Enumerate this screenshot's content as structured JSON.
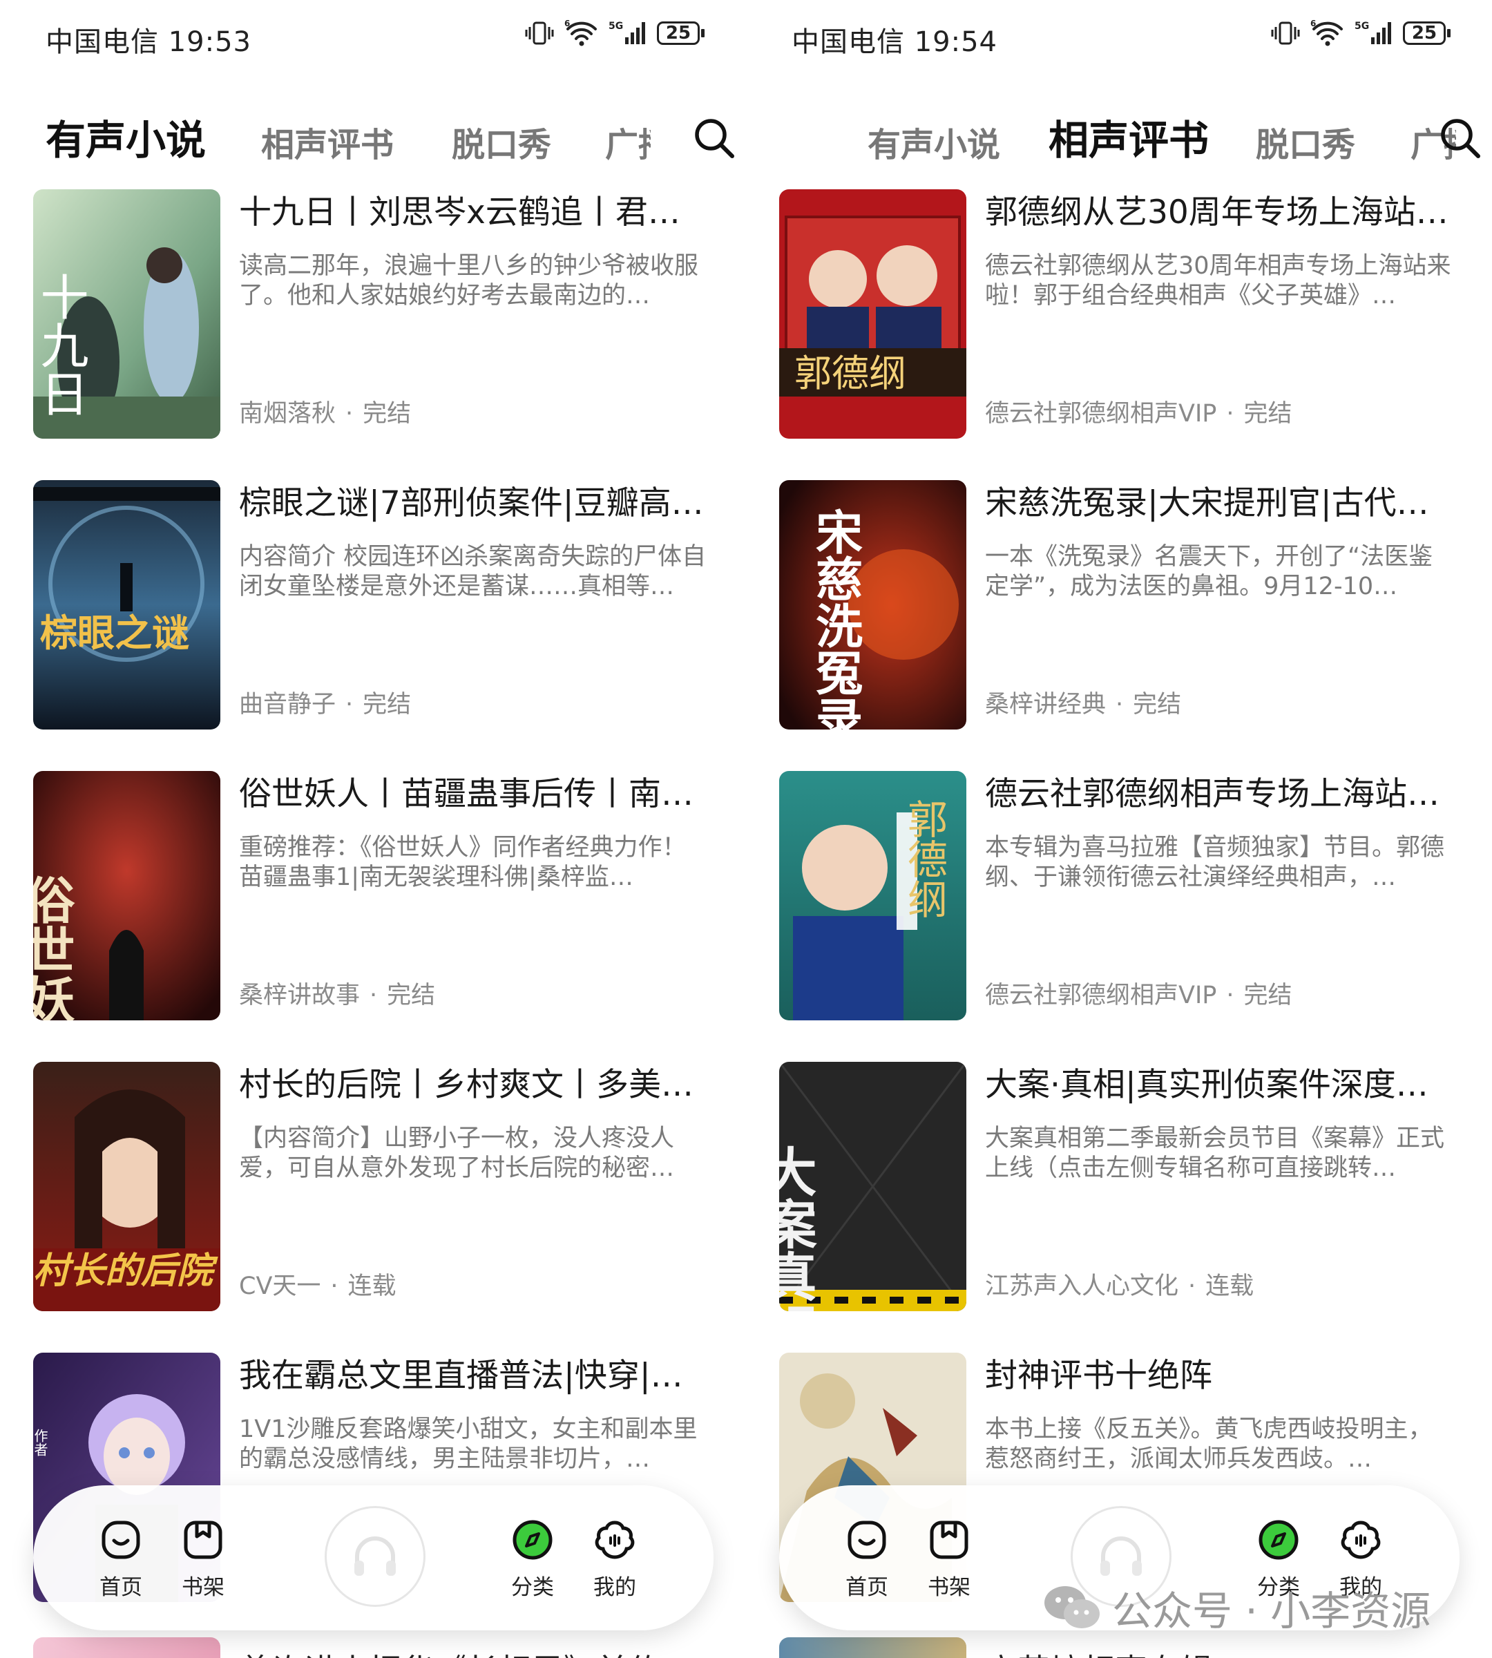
{
  "left": {
    "status": {
      "carrier_time": "中国电信 19:53",
      "battery": "25",
      "signal": "5G"
    },
    "tabs": [
      "有声小说",
      "相声评书",
      "脱口秀",
      "广播"
    ],
    "active_tab": 0,
    "books": [
      {
        "title": "十九日丨刘思岑x云鹤追丨君…",
        "desc": "读高二那年，浪遍十里八乡的钟少爷被收服了。他和人家姑娘约好考去最南边的…",
        "author": "南烟落秋",
        "status": "完结",
        "cover_text": "十九日"
      },
      {
        "title": "棕眼之谜|7部刑侦案件|豆瓣高…",
        "desc": "内容简介 校园连环凶杀案离奇失踪的尸体自闭女童坠楼是意外还是蓄谋……真相等…",
        "author": "曲音静子",
        "status": "完结",
        "cover_text": "棕眼之谜"
      },
      {
        "title": "俗世妖人丨苗疆蛊事后传丨南…",
        "desc": "重磅推荐：《俗世妖人》同作者经典力作！苗疆蛊事1|南无袈裟理科佛|桑梓监…",
        "author": "桑梓讲故事",
        "status": "完结",
        "cover_text": "俗世妖人"
      },
      {
        "title": "村长的后院丨乡村爽文丨多美…",
        "desc": "【内容简介】山野小子一枚，没人疼没人爱，可自从意外发现了村长后院的秘密…",
        "author": "CV天一",
        "status": "连载",
        "cover_text": "村长的后院"
      },
      {
        "title": "我在霸总文里直播普法|快穿|…",
        "desc": "1V1沙雕反套路爆笑小甜文，女主和副本里的霸总没感情线，男主陆景非切片，…",
        "author": "",
        "status": "",
        "cover_text": "作者"
      }
    ],
    "peek_title": "曾许诺丨桐华《长相思》前传"
  },
  "right": {
    "status": {
      "carrier_time": "中国电信 19:54",
      "battery": "25",
      "signal": "5G"
    },
    "tabs": [
      "有声小说",
      "相声评书",
      "脱口秀",
      "广播"
    ],
    "active_tab": 1,
    "books": [
      {
        "title": "郭德纲从艺30周年专场上海站…",
        "desc": "德云社郭德纲从艺30周年相声专场上海站来啦！郭于组合经典相声《父子英雄》…",
        "author": "德云社郭德纲相声VIP",
        "status": "完结",
        "cover_text": "郭德纲"
      },
      {
        "title": "宋慈洗冤录|大宋提刑官|古代…",
        "desc": "一本《洗冤录》名震天下，开创了“法医鉴定学”，成为法医的鼻祖。9月12-10…",
        "author": "桑梓讲经典",
        "status": "完结",
        "cover_text": "宋慈洗冤录"
      },
      {
        "title": "德云社郭德纲相声专场上海站…",
        "desc": "本专辑为喜马拉雅【音频独家】节目。郭德纲、于谦领衔德云社演绎经典相声，…",
        "author": "德云社郭德纲相声VIP",
        "status": "完结",
        "cover_text": "郭德纲"
      },
      {
        "title": "大案·真相|真实刑侦案件深度…",
        "desc": "大案真相第二季最新会员节目《案幕》正式上线（点击左侧专辑名称可直接跳转…",
        "author": "江苏声入人心文化",
        "status": "连载",
        "cover_text": "大案真相"
      },
      {
        "title": "封神评书十绝阵",
        "desc": "本书上接《反五关》。黄飞虎西岐投明主，惹怒商纣王，派闻太师兵发西歧。…",
        "author": "",
        "status": "",
        "cover_text": ""
      }
    ],
    "peek_title": "高英培相声专辑"
  },
  "nav": [
    "首页",
    "书架",
    "分类",
    "我的"
  ],
  "watermark": "公众号 · 小李资源",
  "colors": {
    "accent_green": "#2dbb2d",
    "text_primary": "#1a1a1a",
    "text_secondary": "#7a7a7a"
  }
}
